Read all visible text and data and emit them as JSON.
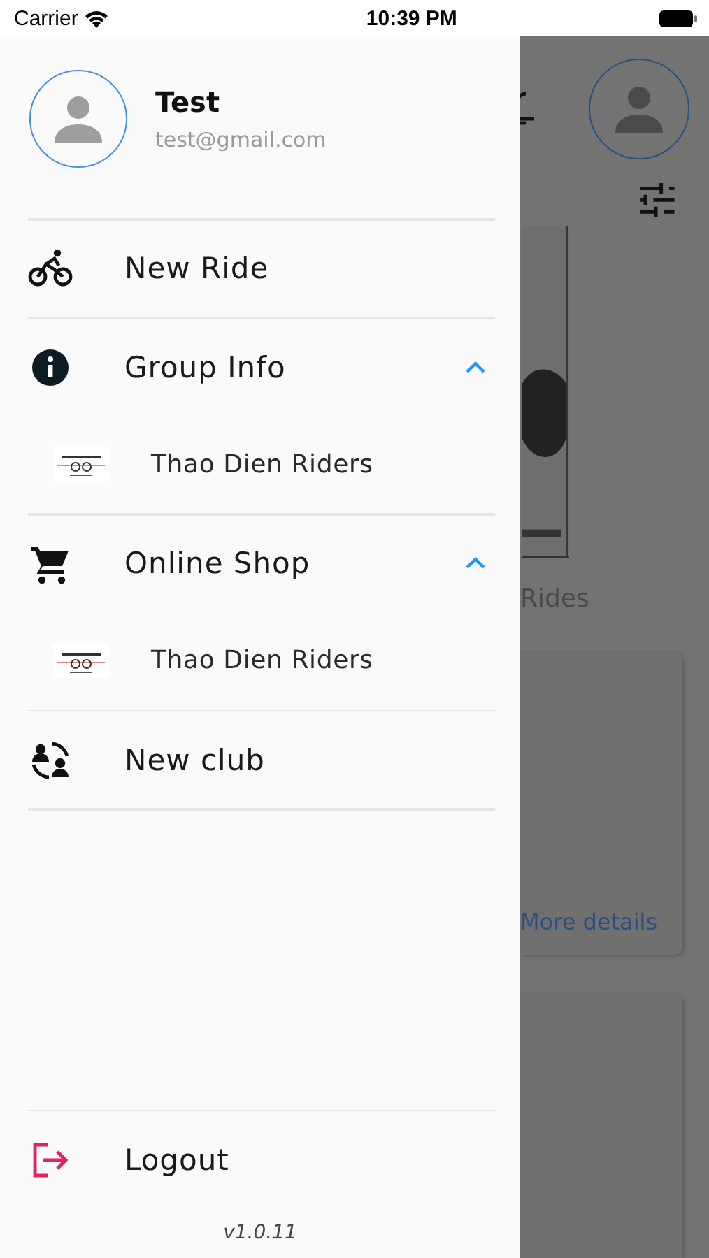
{
  "status_bar": {
    "carrier": "Carrier",
    "time": "10:39 PM"
  },
  "drawer": {
    "user": {
      "name": "Test",
      "email": "test@gmail.com"
    },
    "items": [
      {
        "kind": "item",
        "label": "New Ride"
      },
      {
        "kind": "group",
        "label": "Group Info",
        "expanded": true,
        "children": [
          {
            "label": "Thao Dien Riders"
          }
        ]
      },
      {
        "kind": "group",
        "label": "Online Shop",
        "expanded": true,
        "children": [
          {
            "label": "Thao Dien Riders"
          }
        ]
      },
      {
        "kind": "item",
        "label": "New club"
      }
    ],
    "logout": "Logout",
    "version": "v1.0.11"
  },
  "background": {
    "section_title": "Rides",
    "card_link": "More details"
  }
}
